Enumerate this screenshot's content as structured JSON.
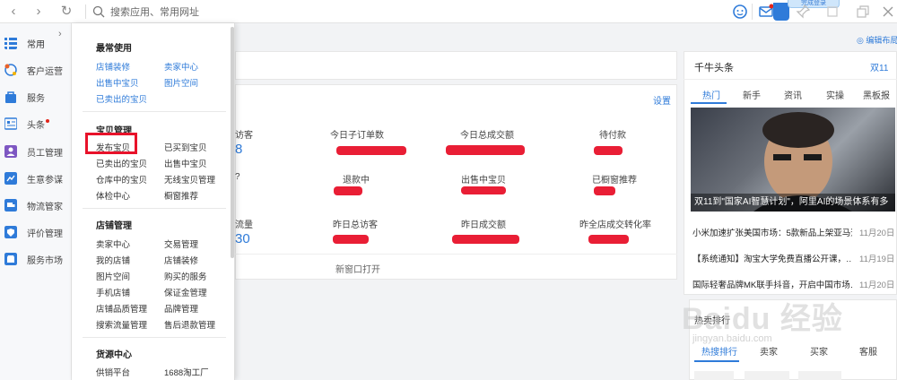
{
  "topbar": {
    "search_placeholder": "搜索应用、常用网址",
    "login_pill": "完成登录",
    "nav": {
      "back": "‹",
      "forward": "›",
      "refresh": "↻"
    }
  },
  "sidebar": {
    "items": [
      {
        "label": "常用",
        "icon": "list-icon",
        "color": "#2f7bd9"
      },
      {
        "label": "客户运营",
        "icon": "star-icon",
        "color": "#e8622a"
      },
      {
        "label": "服务",
        "icon": "bag-icon",
        "color": "#2f7bd9"
      },
      {
        "label": "头条",
        "icon": "news-icon",
        "color": "#2f7bd9"
      },
      {
        "label": "员工管理",
        "icon": "user-icon",
        "color": "#7e57c2"
      },
      {
        "label": "生意参谋",
        "icon": "chart-icon",
        "color": "#2f7bd9"
      },
      {
        "label": "物流管家",
        "icon": "truck-icon",
        "color": "#2f7bd9"
      },
      {
        "label": "评价管理",
        "icon": "shield-icon",
        "color": "#2f7bd9"
      },
      {
        "label": "服务市场",
        "icon": "market-icon",
        "color": "#2f7bd9"
      }
    ]
  },
  "menu": {
    "sections": [
      {
        "title": "最常使用",
        "links": [
          "店铺装修",
          "卖家中心",
          "出售中宝贝",
          "图片空间",
          "已卖出的宝贝"
        ]
      },
      {
        "title": "宝贝管理",
        "links": [
          "发布宝贝",
          "已买到宝贝",
          "已卖出的宝贝",
          "出售中宝贝",
          "仓库中的宝贝",
          "无线宝贝管理",
          "体检中心",
          "橱窗推荐"
        ]
      },
      {
        "title": "店铺管理",
        "links": [
          "卖家中心",
          "交易管理",
          "我的店铺",
          "店铺装修",
          "图片空间",
          "购买的服务",
          "手机店铺",
          "保证金管理",
          "店铺品质管理",
          "品牌管理",
          "搜索流量管理",
          "售后退款管理"
        ]
      },
      {
        "title": "货源中心",
        "links": [
          "供销平台",
          "1688淘工厂"
        ]
      }
    ]
  },
  "main": {
    "edit_layout": "◎ 编辑布局",
    "setting": "设置",
    "new_window": "新窗口打开",
    "stats": [
      {
        "label": "访客",
        "value": "8"
      },
      {
        "label": "今日子订单数",
        "value": ""
      },
      {
        "label": "今日总成交额",
        "value": ""
      },
      {
        "label": "待付款",
        "value": ""
      },
      {
        "label": "",
        "value": "?"
      },
      {
        "label": "退款中",
        "value": ""
      },
      {
        "label": "出售中宝贝",
        "value": ""
      },
      {
        "label": "已橱窗推荐",
        "value": ""
      },
      {
        "label": "流量",
        "value": "30"
      },
      {
        "label": "昨日总访客",
        "value": ""
      },
      {
        "label": "昨日成交额",
        "value": ""
      },
      {
        "label": "昨全店成交转化率",
        "value": ""
      }
    ]
  },
  "right": {
    "title": "千牛头条",
    "link": "双11",
    "tabs": [
      "热门",
      "新手",
      "资讯",
      "实操",
      "黑板报"
    ],
    "headline": "双11到\"国家AI智慧计划\"，阿里AI的场景体系有多",
    "news": [
      {
        "title": "小米加速扩张美国市场：5款新品上架亚马逊",
        "date": "11月20日"
      },
      {
        "title": "【系统通知】淘宝大学免费直播公开课，…",
        "date": "11月19日"
      },
      {
        "title": "国际轻奢品牌MK联手抖音，开启中国市场…",
        "date": "11月20日"
      }
    ],
    "ranking_title": "热卖排行",
    "ranking_tabs": [
      "热搜排行",
      "卖家",
      "买家",
      "客服"
    ]
  },
  "watermark": {
    "main": "Baidu 经验",
    "sub": "jingyan.baidu.com"
  }
}
